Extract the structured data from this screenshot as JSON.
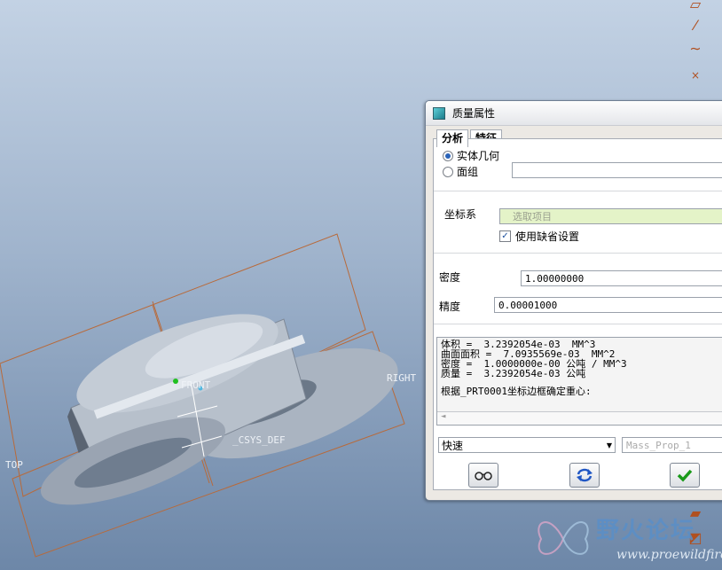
{
  "viewport": {
    "datum_labels": {
      "front": "FRONT",
      "right": "RIGHT",
      "top": "TOP",
      "csys": "_CSYS_DEF"
    }
  },
  "dialog": {
    "title": "质量属性",
    "tabs": [
      {
        "label": "分析",
        "active": true
      },
      {
        "label": "特征",
        "active": false
      }
    ],
    "geometry_options": [
      {
        "label": "实体几何",
        "selected": true
      },
      {
        "label": "面组",
        "selected": false
      }
    ],
    "quilt_value": "",
    "csys_label": "坐标系",
    "csys_placeholder": "选取项目",
    "use_default_label": "使用缺省设置",
    "use_default_checked": true,
    "density_label": "密度",
    "density_value": "1.00000000",
    "accuracy_label": "精度",
    "accuracy_value": "0.00001000",
    "results": [
      "体积 =  3.2392054e-03  MM^3",
      "曲面面积 =  7.0935569e-03  MM^2",
      "密度 =  1.0000000e-00 公吨 / MM^3",
      "质量 =  3.2392054e-03 公吨",
      "",
      "根据_PRT0001坐标边框确定重心:"
    ],
    "mode_value": "快速",
    "name_placeholder": "Mass_Prop_1"
  },
  "watermark": {
    "text": "野火论坛",
    "url": "www.proewildfire.cn"
  },
  "colors": {
    "csys_field_bg": "#e4f3c8",
    "accent": "#2a63b8",
    "ok_green": "#1a9a1a",
    "repeat_blue": "#1f56c4"
  }
}
